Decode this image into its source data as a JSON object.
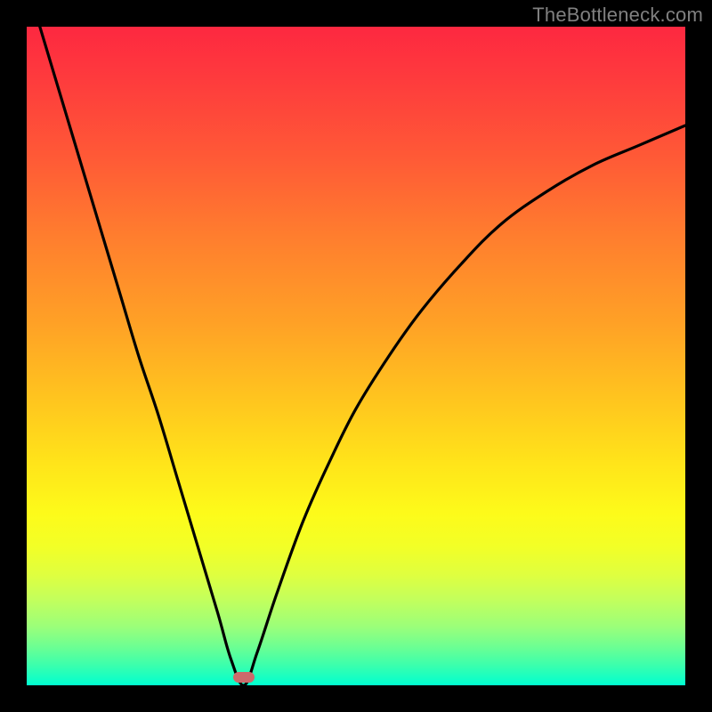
{
  "watermark": "TheBottleneck.com",
  "colors": {
    "frame": "#000000",
    "gradient_stops": [
      "#fd2840",
      "#fe3b3d",
      "#ff5a36",
      "#ff7e2e",
      "#ffa126",
      "#ffc31f",
      "#ffe31a",
      "#fdfb1a",
      "#f2ff27",
      "#e0ff3e",
      "#c3ff5c",
      "#9cff79",
      "#6fff91",
      "#3affad",
      "#00ffd0"
    ],
    "curve": "#000000",
    "marker": "#cc6a6b"
  },
  "chart_data": {
    "type": "line",
    "title": "",
    "xlabel": "",
    "ylabel": "",
    "xlim": [
      0,
      100
    ],
    "ylim": [
      0,
      100
    ],
    "grid": false,
    "legend": false,
    "note": "Single V-shaped bottleneck curve over a red-to-green vertical gradient. y is the mismatch percentage (0 = green band at bottom, 100 = red at top). Minimum at x ≈ 33 where y ≈ 0. Values estimated visually from the plot.",
    "series": [
      {
        "name": "bottleneck-curve",
        "x": [
          2,
          5,
          8,
          11,
          14,
          17,
          20,
          23,
          26,
          29,
          31,
          33,
          35,
          38,
          42,
          46,
          50,
          55,
          60,
          66,
          72,
          79,
          86,
          93,
          100
        ],
        "y": [
          100,
          90,
          80,
          70,
          60,
          50,
          41,
          31,
          21,
          11,
          4,
          0,
          5,
          14,
          25,
          34,
          42,
          50,
          57,
          64,
          70,
          75,
          79,
          82,
          85
        ]
      }
    ],
    "marker": {
      "x": 33,
      "y": 1.2
    }
  }
}
